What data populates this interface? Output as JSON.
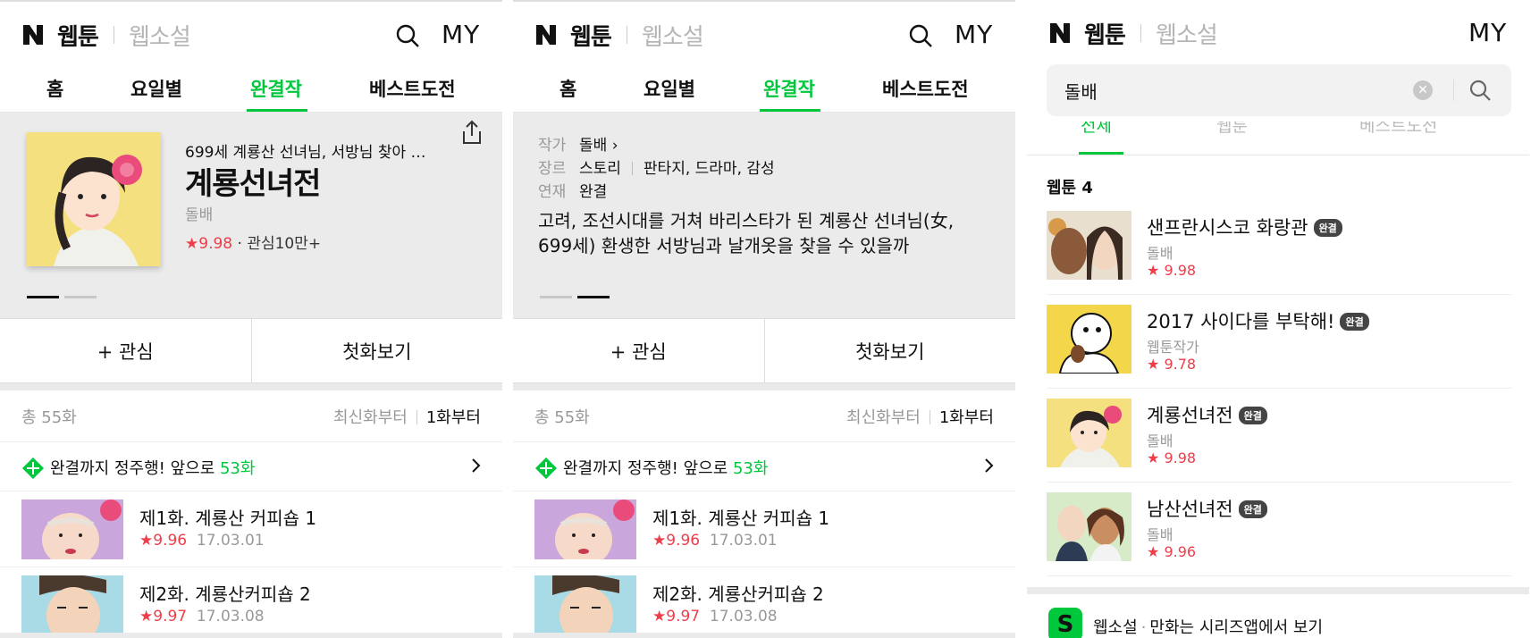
{
  "header": {
    "title": "웹툰",
    "sub": "웹소설",
    "my": "MY"
  },
  "tabs": [
    "홈",
    "요일별",
    "완결작",
    "베스트도전"
  ],
  "series": {
    "description": "699세 계룡산 선녀님, 서방님 찾아 …",
    "title": "계룡선녀전",
    "author": "돌배",
    "rating_star": "★",
    "rating": "9.98",
    "interest": "· 관심10만+",
    "meta": {
      "author_key": "작가",
      "author_val": "돌배",
      "genre_key": "장르",
      "genre_val1": "스토리",
      "genre_val2": "판타지, 드라마, 감성",
      "status_key": "연재",
      "status_val": "완결"
    },
    "synopsis": "고려, 조선시대를 거쳐 바리스타가 된 계룡산 선녀님(女, 699세) 환생한 서방님과 날개옷을 찾을 수 있을까"
  },
  "actions": {
    "follow": "+ 관심",
    "first": "첫화보기"
  },
  "list": {
    "total": "총 55화",
    "sort_latest": "최신화부터",
    "sort_first": "1화부터",
    "promo_prefix": "완결까지 정주행! 앞으로 ",
    "promo_count": "53화",
    "episodes": [
      {
        "title": "제1화. 계룡산 커피숍 1",
        "rating": "9.96",
        "date": "17.03.01"
      },
      {
        "title": "제2화. 계룡산커피숍 2",
        "rating": "9.97",
        "date": "17.03.08"
      }
    ]
  },
  "search": {
    "query": "돌배",
    "tabs": [
      "전체",
      "웹툰",
      "베스트도전"
    ],
    "section_label": "웹툰 4",
    "badge": "완결",
    "results": [
      {
        "title": "샌프란시스코 화랑관",
        "author": "돌배",
        "rating": "9.98"
      },
      {
        "title": "2017 사이다를 부탁해!",
        "author": "웹툰작가",
        "rating": "9.78"
      },
      {
        "title": "계룡선녀전",
        "author": "돌배",
        "rating": "9.98"
      },
      {
        "title": "남산선녀전",
        "author": "돌배",
        "rating": "9.96"
      }
    ],
    "footer_icon": "S",
    "footer_a": "웹소설",
    "footer_sep": "·",
    "footer_b": "만화는 시리즈앱에서 보기"
  },
  "colors": {
    "accent": "#00c73c",
    "rating": "#ef3d49"
  },
  "icons": [
    "naver-logo-icon",
    "search-icon",
    "share-icon",
    "chevron-right-icon",
    "clear-icon",
    "diamond-icon"
  ]
}
